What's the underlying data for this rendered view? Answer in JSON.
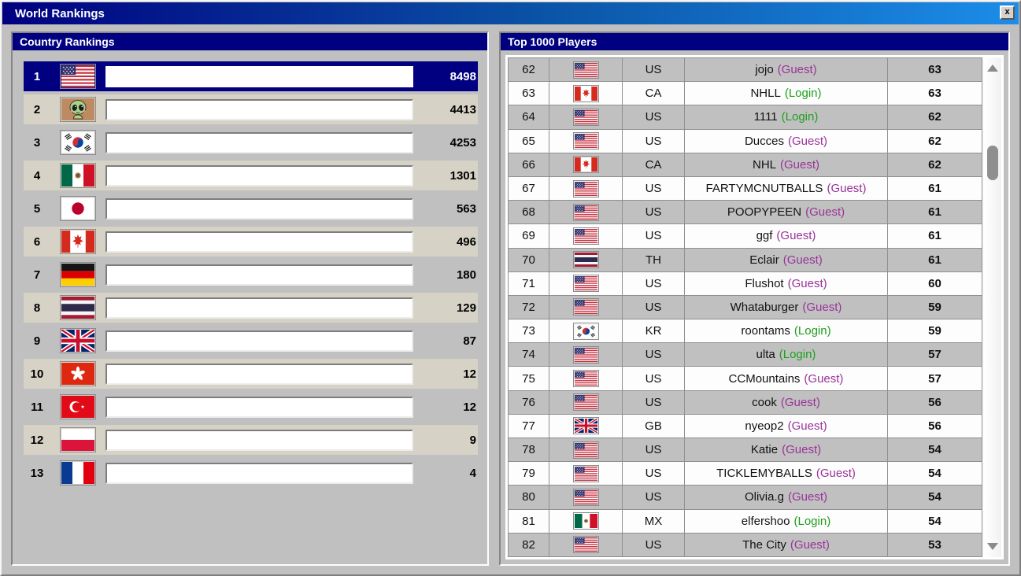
{
  "window": {
    "title": "World Rankings",
    "close_label": "x"
  },
  "country_panel": {
    "title": "Country Rankings",
    "rows": [
      {
        "rank": "1",
        "flag": "us",
        "score": "8498",
        "selected": true
      },
      {
        "rank": "2",
        "flag": "alien",
        "score": "4413"
      },
      {
        "rank": "3",
        "flag": "kr",
        "score": "4253"
      },
      {
        "rank": "4",
        "flag": "mx",
        "score": "1301"
      },
      {
        "rank": "5",
        "flag": "jp",
        "score": "563"
      },
      {
        "rank": "6",
        "flag": "ca",
        "score": "496"
      },
      {
        "rank": "7",
        "flag": "de",
        "score": "180"
      },
      {
        "rank": "8",
        "flag": "th",
        "score": "129"
      },
      {
        "rank": "9",
        "flag": "gb",
        "score": "87"
      },
      {
        "rank": "10",
        "flag": "hk",
        "score": "12"
      },
      {
        "rank": "11",
        "flag": "tr",
        "score": "12"
      },
      {
        "rank": "12",
        "flag": "pl",
        "score": "9"
      },
      {
        "rank": "13",
        "flag": "fr",
        "score": "4"
      }
    ]
  },
  "players_panel": {
    "title": "Top 1000 Players",
    "rows": [
      {
        "rank": "62",
        "flag": "us",
        "code": "US",
        "name": "jojo",
        "tag": "(Guest)",
        "score": "63"
      },
      {
        "rank": "63",
        "flag": "ca",
        "code": "CA",
        "name": "NHLL",
        "tag": "(Login)",
        "score": "63"
      },
      {
        "rank": "64",
        "flag": "us",
        "code": "US",
        "name": "1111",
        "tag": "(Login)",
        "score": "62"
      },
      {
        "rank": "65",
        "flag": "us",
        "code": "US",
        "name": "Ducces",
        "tag": "(Guest)",
        "score": "62"
      },
      {
        "rank": "66",
        "flag": "ca",
        "code": "CA",
        "name": "NHL",
        "tag": "(Guest)",
        "score": "62"
      },
      {
        "rank": "67",
        "flag": "us",
        "code": "US",
        "name": "FARTYMCNUTBALLS",
        "tag": "(Guest)",
        "score": "61"
      },
      {
        "rank": "68",
        "flag": "us",
        "code": "US",
        "name": "POOPYPEEN",
        "tag": "(Guest)",
        "score": "61"
      },
      {
        "rank": "69",
        "flag": "us",
        "code": "US",
        "name": "ggf",
        "tag": "(Guest)",
        "score": "61"
      },
      {
        "rank": "70",
        "flag": "th",
        "code": "TH",
        "name": "Eclair",
        "tag": "(Guest)",
        "score": "61"
      },
      {
        "rank": "71",
        "flag": "us",
        "code": "US",
        "name": "Flushot",
        "tag": "(Guest)",
        "score": "60"
      },
      {
        "rank": "72",
        "flag": "us",
        "code": "US",
        "name": "Whataburger",
        "tag": "(Guest)",
        "score": "59"
      },
      {
        "rank": "73",
        "flag": "kr",
        "code": "KR",
        "name": "roontams",
        "tag": "(Login)",
        "score": "59"
      },
      {
        "rank": "74",
        "flag": "us",
        "code": "US",
        "name": "ulta",
        "tag": "(Login)",
        "score": "57"
      },
      {
        "rank": "75",
        "flag": "us",
        "code": "US",
        "name": "CCMountains",
        "tag": "(Guest)",
        "score": "57"
      },
      {
        "rank": "76",
        "flag": "us",
        "code": "US",
        "name": "cook",
        "tag": "(Guest)",
        "score": "56"
      },
      {
        "rank": "77",
        "flag": "gb",
        "code": "GB",
        "name": "nyeop2",
        "tag": "(Guest)",
        "score": "56"
      },
      {
        "rank": "78",
        "flag": "us",
        "code": "US",
        "name": "Katie",
        "tag": "(Guest)",
        "score": "54"
      },
      {
        "rank": "79",
        "flag": "us",
        "code": "US",
        "name": "TICKLEMYBALLS",
        "tag": "(Guest)",
        "score": "54"
      },
      {
        "rank": "80",
        "flag": "us",
        "code": "US",
        "name": "Olivia.g",
        "tag": "(Guest)",
        "score": "54"
      },
      {
        "rank": "81",
        "flag": "mx",
        "code": "MX",
        "name": "elfershoo",
        "tag": "(Login)",
        "score": "54"
      },
      {
        "rank": "82",
        "flag": "us",
        "code": "US",
        "name": "The City",
        "tag": "(Guest)",
        "score": "53"
      }
    ]
  },
  "colors": {
    "titlebar_gradient_start": "#000080",
    "titlebar_gradient_end": "#1c8de9",
    "panel_header": "#000080",
    "window_background": "#c0c0c0",
    "row_stripe_beige": "#d6d2c6",
    "table_row_gray": "#c0c0c0",
    "selected_row": "#000080",
    "bar_gradient_start": "#000070",
    "bar_gradient_end": "#1b89dd",
    "guest_tag": "#993399",
    "login_tag": "#1f9e1f"
  }
}
